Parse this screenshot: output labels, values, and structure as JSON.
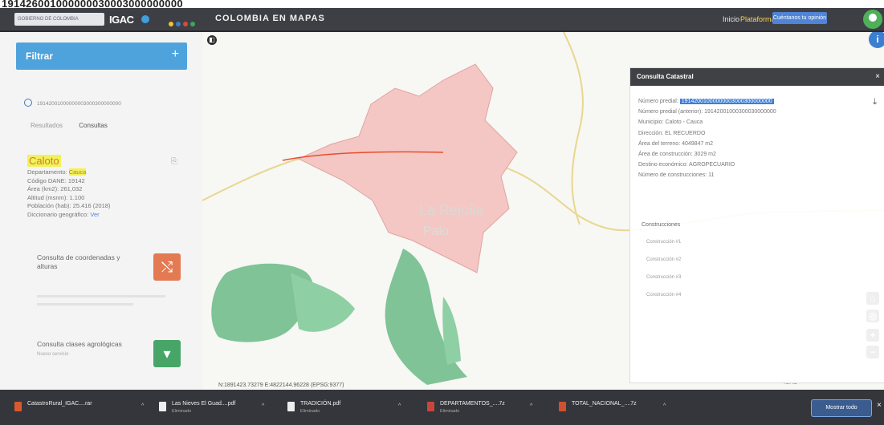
{
  "banner": "191426001000000030003000000000",
  "topbar": {
    "gov_logo": "GOBIERNO DE COLOMBIA",
    "igac_logo": "IGAC",
    "title": "COLOMBIA EN MAPAS",
    "links": [
      "Inicio",
      "Plataforma"
    ],
    "user_button": "Cuéntanos tu opinión",
    "dot_colors": [
      "#f2c230",
      "#3b7fc4",
      "#d84a3a",
      "#3fa55a"
    ]
  },
  "panel": {
    "filter_label": "Filtrar",
    "search_value": "19142001000000003000300000000",
    "tabs": [
      "Resultados",
      "Consultas"
    ],
    "place": {
      "name": "Caloto",
      "rows": [
        {
          "k": "Departamento:",
          "v": "Cauca"
        },
        {
          "k": "Código DANE:",
          "v": "19142"
        },
        {
          "k": "Área (km2):",
          "v": "261,032"
        },
        {
          "k": "Altitud (msnm):",
          "v": "1.100"
        },
        {
          "k": "Población (hab):",
          "v": "25.416 (2018)"
        },
        {
          "k": "Diccionario geográfico:",
          "v": "Ver"
        }
      ]
    },
    "tools": [
      {
        "label": "Consulta de coordenadas y alturas",
        "icon": "crosshair-icon",
        "color": "#e37a52",
        "glyph": "⤭"
      },
      {
        "label": "Consulta clases agrológicas",
        "icon": "leaf-icon",
        "color": "#47a667",
        "glyph": "▾",
        "sub": "Nuevo servicio"
      }
    ]
  },
  "map": {
    "toggle": "◧",
    "coords": "N:1891423.73279 E:4822144.96228 (EPSG:9377)",
    "attribution": "IGAC",
    "info": "i",
    "controls": [
      "⌂",
      "◎",
      "+",
      "−"
    ],
    "labels": [
      "La Rejoila",
      "Palo"
    ]
  },
  "popup": {
    "title": "Consulta Catastral",
    "close": "×",
    "rows": [
      {
        "k": "Número predial:",
        "v": "19142001000000003000300000000",
        "selected": true
      },
      {
        "k": "Número predial (anterior):",
        "v": "19142001000300030000000"
      },
      {
        "k": "Municipio:",
        "v": "Caloto - Cauca"
      },
      {
        "k": "Dirección:",
        "v": "EL RECUERDO"
      },
      {
        "k": "Área del terreno:",
        "v": "4049847 m2"
      },
      {
        "k": "Área de construcción:",
        "v": "3029 m2"
      },
      {
        "k": "Destino económico:",
        "v": "AGROPECUARIO"
      },
      {
        "k": "Número de construcciones:",
        "v": "11"
      }
    ],
    "constructions_label": "Construcciones",
    "constructions": [
      "Construcción #1",
      "Construcción #2",
      "Construcción #3",
      "Construcción #4"
    ]
  },
  "downloads": [
    {
      "name": "CatastroRural_IGAC....rar",
      "status": "",
      "color": "#d65a2e"
    },
    {
      "name": "Las Nieves El Guad....pdf",
      "status": "Eliminado",
      "color": "#eeeeee"
    },
    {
      "name": "TRADICIÓN.pdf",
      "status": "Eliminado",
      "color": "#eeeeee"
    },
    {
      "name": "DEPARTAMENTOS_....7z",
      "status": "Eliminado",
      "color": "#c9473a"
    },
    {
      "name": "TOTAL_NACIONAL_....7z",
      "status": "",
      "color": "#d05030"
    }
  ],
  "taskbar": {
    "show_all": "Mostrar todo",
    "close": "×"
  }
}
